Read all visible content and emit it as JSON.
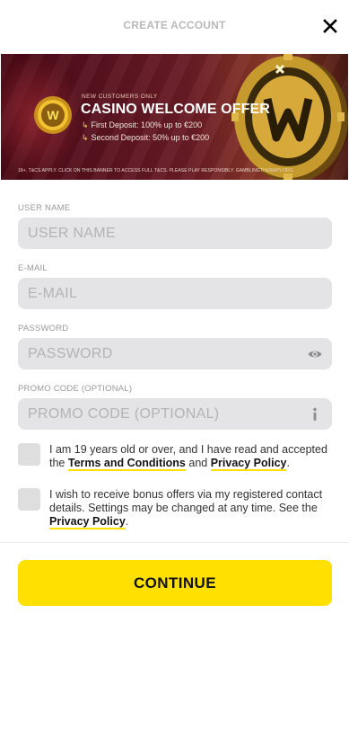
{
  "header": {
    "title": "CREATE ACCOUNT",
    "close_icon": "close-icon"
  },
  "banner": {
    "eyebrow": "NEW CUSTOMERS ONLY",
    "title": "CASINO WELCOME OFFER",
    "lines": [
      {
        "arrow": "↳",
        "text": "First Deposit: 100% up to €200"
      },
      {
        "arrow": "↳",
        "text": "Second Deposit: 50% up to €200"
      }
    ],
    "footnote": "18+. T&CS APPLY. CLICK ON THIS BANNER TO ACCESS FULL T&CS. PLEASE PLAY RESPONSIBLY. GAMBLINGTHERAPY.ORG",
    "logo_letter": "W"
  },
  "form": {
    "username": {
      "label": "USER NAME",
      "placeholder": "USER NAME",
      "value": ""
    },
    "email": {
      "label": "E-MAIL",
      "placeholder": "E-MAIL",
      "value": ""
    },
    "password": {
      "label": "PASSWORD",
      "placeholder": "PASSWORD",
      "value": "",
      "icon": "eye-icon"
    },
    "promo": {
      "label": "PROMO CODE (OPTIONAL)",
      "placeholder": "PROMO CODE (OPTIONAL)",
      "value": "",
      "icon": "info-icon"
    }
  },
  "consent": {
    "age": {
      "checked": false,
      "text_before": "I am 19 years old or over, and I have read and accepted the ",
      "link_terms": "Terms and Conditions",
      "text_and": " and ",
      "link_privacy": "Privacy Policy",
      "text_after": "."
    },
    "marketing": {
      "checked": false,
      "text_before": "I wish to receive bonus offers via my registered contact details. Settings may be changed at any time. See the ",
      "link_privacy": "Privacy Policy",
      "text_after": "."
    }
  },
  "actions": {
    "continue_label": "CONTINUE"
  },
  "colors": {
    "accent": "#ffe000",
    "input_bg": "#e4e4e6",
    "label": "#9a9a9a",
    "banner_bg": "#5a1320"
  }
}
